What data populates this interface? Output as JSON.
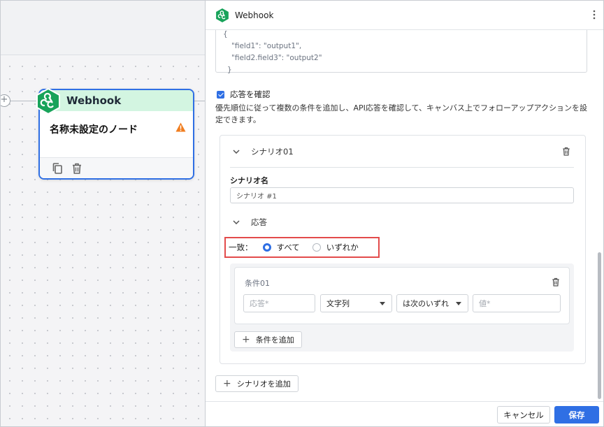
{
  "canvas": {
    "node": {
      "type_label": "Webhook",
      "title": "名称未設定のノード",
      "icons": [
        "webhook-icon",
        "warning-icon",
        "copy-icon",
        "trash-icon"
      ]
    }
  },
  "panel": {
    "header": {
      "title": "Webhook",
      "icon": "webhook-icon"
    },
    "code_lines": [
      "{",
      "\"field1\": \"output1\",",
      "\"field2.field3\": \"output2\"",
      "}"
    ],
    "validate": {
      "checked": true,
      "label": "応答を確認",
      "description": "優先順位に従って複数の条件を追加し、API応答を確認して、キャンバス上でフォローアップアクションを設定できます。"
    },
    "scenario": {
      "header_label": "シナリオ01",
      "name_label": "シナリオ名",
      "name_value": "シナリオ #1",
      "response_label": "応答",
      "match": {
        "label": "一致：",
        "options": [
          "すべて",
          "いずれか"
        ],
        "selected": "すべて"
      },
      "condition": {
        "title": "条件01",
        "response_placeholder": "応答*",
        "type_value": "文字列",
        "operator_value": "は次のいずれ",
        "value_placeholder": "値*"
      },
      "add_condition_label": "条件を追加"
    },
    "add_scenario_label": "シナリオを追加"
  },
  "footer": {
    "cancel_label": "キャンセル",
    "save_label": "保存"
  },
  "colors": {
    "accent": "#2f6fe4",
    "node_header": "#d3f5e1",
    "brand_green": "#18a35a",
    "highlight": "#e34b4b",
    "warning": "#f07d1f"
  }
}
